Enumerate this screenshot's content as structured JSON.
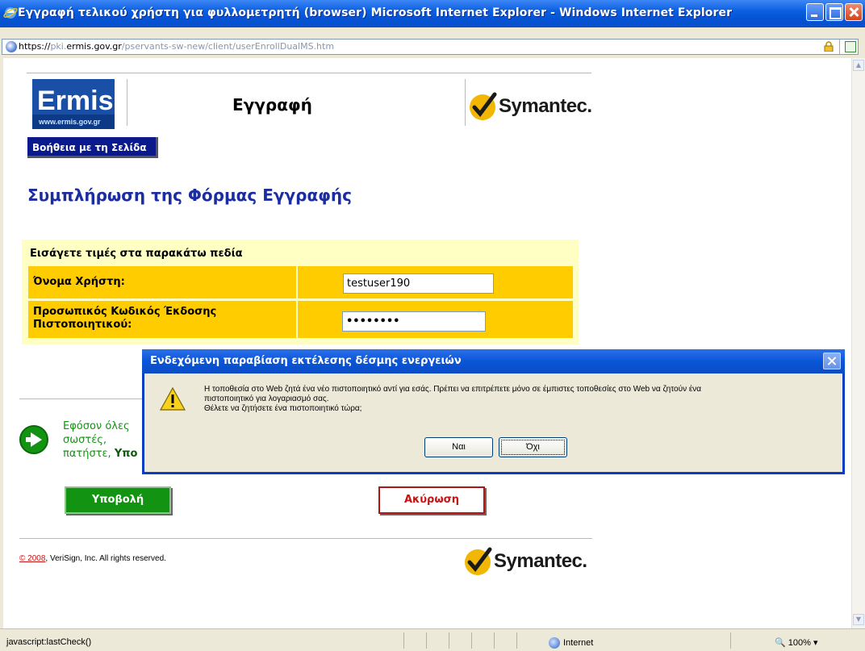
{
  "window": {
    "title": "Εγγραφή τελικού χρήστη για φυλλομετρητή (browser) Microsoft Internet Explorer - Windows Internet Explorer"
  },
  "address": {
    "protocol": "https://",
    "host_pre": "pki.",
    "host": "ermis.gov.gr",
    "path": "/pservants-sw-new/client/userEnrollDualMS.htm"
  },
  "page": {
    "logo_text": "Ermis.",
    "logo_subtext": "www.ermis.gov.gr",
    "heading": "Εγγραφή",
    "brand": "Symantec.",
    "help_button": "Βοήθεια με τη Σελίδα",
    "form_title": "Συμπλήρωση της Φόρμας Εγγραφής",
    "form_caption": "Εισάγετε τιμές στα παρακάτω πεδία",
    "fields": [
      {
        "label": "Όνομα Χρήστη:",
        "value": "testuser190"
      },
      {
        "label_line1": "Προσωπικός Κωδικός Έκδοσης",
        "label_line2": "Πιστοποιητικού:",
        "value": "••••••••"
      }
    ],
    "instructions_line1": "Εφόσον όλες",
    "instructions_line2": "σωστές,",
    "instructions_line3_pre": "πατήστε, ",
    "instructions_line3_bold": "Υπο",
    "submit_button": "Υποβολή",
    "cancel_button": "Ακύρωση",
    "copyright_link": "© 2008",
    "copyright_rest": ", VeriSign, Inc. All rights reserved."
  },
  "dialog": {
    "title": "Ενδεχόμενη παραβίαση εκτέλεσης δέσμης ενεργειών",
    "message_line1": "Η τοποθεσία στο Web ζητά ένα νέο πιστοποιητικό αντί για εσάς. Πρέπει να επιτρέπετε μόνο σε έμπιστες τοποθεσίες στο Web να ζητούν ένα",
    "message_line2": "πιστοποιητικό για λογαριασμό σας.",
    "message_line3": "Θέλετε να  ζητήσετε ένα πιστοποιητικό τώρα;",
    "yes_button": "Ναι",
    "no_button": "Όχι"
  },
  "status": {
    "text": "javascript:lastCheck()",
    "zone": "Internet",
    "zoom": "100%"
  },
  "colors": {
    "title_blue": "#0553d4",
    "form_title": "#1b2da0",
    "form_bg": "#ffffc4",
    "row_bg": "#ffcc00",
    "submit_green": "#129412",
    "cancel_red": "#c81414"
  }
}
